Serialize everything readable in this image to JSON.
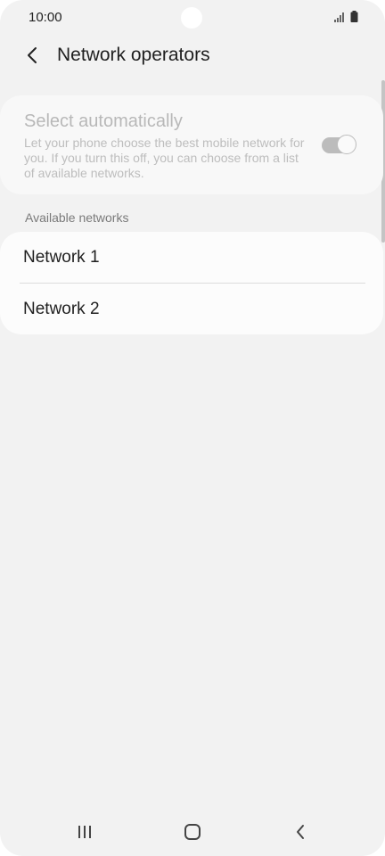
{
  "status_bar": {
    "time": "10:00",
    "icons": [
      "signal-icon",
      "battery-icon"
    ]
  },
  "app_bar": {
    "back_icon": "chevron-left-icon",
    "title": "Network operators"
  },
  "auto_select": {
    "title": "Select automatically",
    "description": "Let your phone choose the best mobile network for you. If you turn this off, you can choose from a list of available networks.",
    "toggle_state": "on",
    "enabled": false
  },
  "available_networks": {
    "header": "Available networks",
    "items": [
      {
        "label": "Network 1"
      },
      {
        "label": "Network 2"
      }
    ]
  },
  "nav_bar": {
    "buttons": [
      "recents-icon",
      "home-icon",
      "back-icon"
    ]
  },
  "colors": {
    "background": "#f2f2f2",
    "card": "#fcfcfc",
    "disabled_text": "#b8b8b8",
    "primary_text": "#1f1f1f"
  }
}
